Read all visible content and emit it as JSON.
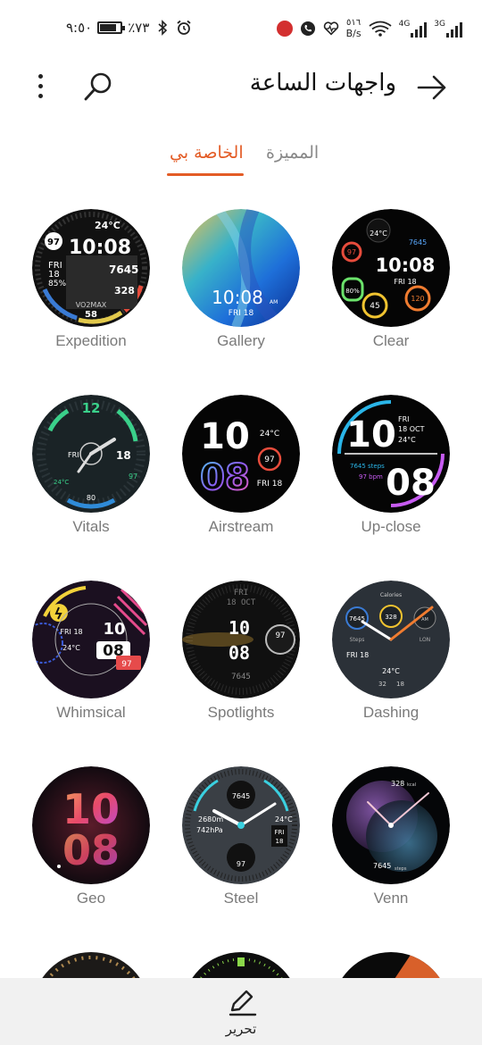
{
  "status_bar": {
    "time": "٩:٥٠",
    "battery_percent": "٪٧٣",
    "net_speed_value": "٥١٦",
    "net_speed_unit": "B/s",
    "signal_1_label": "4G",
    "signal_2_label": "3G"
  },
  "header": {
    "title": "واجهات الساعة",
    "back_icon": "arrow-right-icon",
    "search_icon": "search-icon",
    "more_icon": "more-vertical-icon"
  },
  "tabs": [
    {
      "label": "الخاصة بي",
      "active": true
    },
    {
      "label": "المميزة",
      "active": false
    }
  ],
  "accent_color": "#e35c26",
  "watch_faces": [
    {
      "name": "Expedition"
    },
    {
      "name": "Gallery"
    },
    {
      "name": "Clear"
    },
    {
      "name": "Vitals"
    },
    {
      "name": "Airstream"
    },
    {
      "name": "Up-close"
    },
    {
      "name": "Whimsical"
    },
    {
      "name": "Spotlights"
    },
    {
      "name": "Dashing"
    },
    {
      "name": "Geo"
    },
    {
      "name": "Steel"
    },
    {
      "name": "Venn"
    }
  ],
  "face_text": {
    "expedition": {
      "temp": "24°C",
      "time": "10:08",
      "day": "FRI",
      "date": "18",
      "battery": "85%",
      "steps": "7645",
      "cal": "328",
      "hr": "97",
      "vo2": "VO2MAX",
      "vo2_val": "58"
    },
    "gallery": {
      "time": "10:08",
      "ampm": "AM",
      "date": "FRI 18"
    },
    "clear": {
      "temp": "24°C",
      "steps": "7645",
      "hr": "97",
      "time": "10:08",
      "day": "FRI 18",
      "battery": "80%",
      "cal": "120",
      "act": "45"
    },
    "vitals": {
      "hour": "12",
      "day": "FRI",
      "date": "18",
      "temp": "24°C",
      "hr": "97",
      "cal": "80"
    },
    "airstream": {
      "hour": "10",
      "min": "08",
      "temp": "24°C",
      "hr": "97",
      "date": "FRI 18"
    },
    "upclose": {
      "hour": "10",
      "min": "08",
      "date": "FRI",
      "date2": "18 OCT",
      "temp": "24°C",
      "steps": "7645 steps",
      "hr": "97 bpm"
    },
    "whimsical": {
      "hour": "10",
      "min": "08",
      "date": "FRI 18",
      "temp": "24°C",
      "hr": "97"
    },
    "spotlights": {
      "day": "FRI",
      "date": "18 OCT",
      "hour": "10",
      "min": "08",
      "hr": "97",
      "steps": "7645"
    },
    "dashing": {
      "top": "Calories",
      "steps": "7645",
      "cal": "328",
      "am": "AM",
      "steps_label": "Steps",
      "city": "LON",
      "date": "FRI 18",
      "temp": "24°C",
      "hi": "32",
      "lo": "18"
    },
    "geo": {
      "hour": "10",
      "min": "08"
    },
    "steel": {
      "steps": "7645",
      "alt": "2680m",
      "press": "742hPa",
      "temp": "24°C",
      "day": "FRI",
      "date": "18",
      "hr": "97"
    },
    "venn": {
      "cal": "328",
      "cal_unit": "kcal",
      "steps": "7645",
      "steps_unit": "steps"
    }
  },
  "bottom_bar": {
    "edit_label": "تحرير",
    "edit_icon": "pencil-icon"
  }
}
